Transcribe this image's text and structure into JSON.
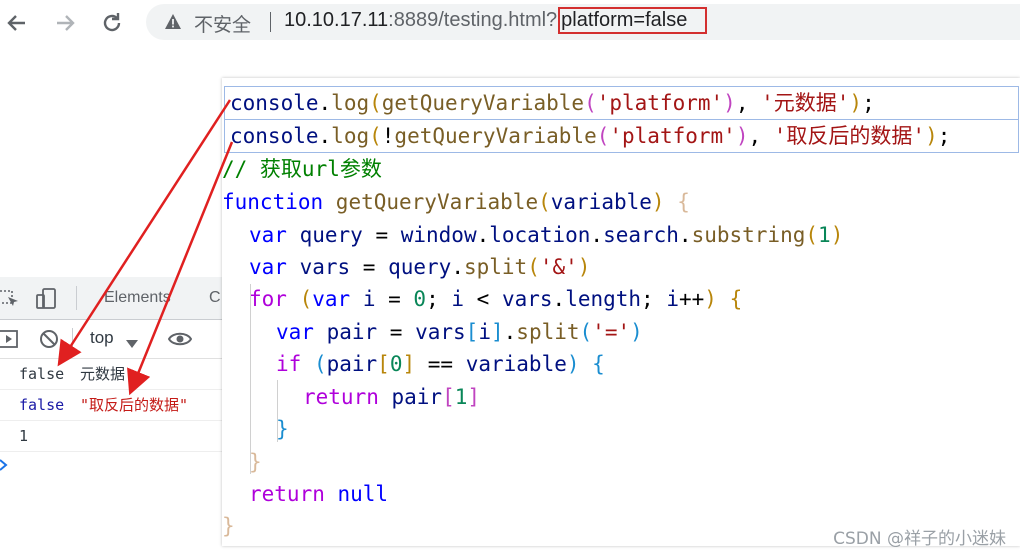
{
  "browser": {
    "security_label": "不安全",
    "url_host": "10.10.17.11",
    "url_port_path": ":8889/testing.html?",
    "url_query": "platform=false"
  },
  "devtools": {
    "tab_elements": "Elements",
    "tab_partial": "C",
    "context": "top",
    "lines": [
      {
        "value": "false",
        "text": "元数据",
        "color": "#303942",
        "text_color": "#303942"
      },
      {
        "value": "false",
        "text": "\"取反后的数据\"",
        "color": "#1a1aa6",
        "text_color": "#c41a16"
      },
      {
        "value": "1",
        "text": "",
        "color": "#303942",
        "text_color": "#303942"
      }
    ]
  },
  "code": {
    "line0": {
      "a": "console",
      "b": ".",
      "c": "log",
      "d": "(",
      "e": "getQueryVariable",
      "f": "(",
      "g": "'platform'",
      "h": ")",
      "i": ", ",
      "j": "'元数据'",
      "k": ")",
      "l": ";"
    },
    "line1": {
      "a": "console",
      "b": ".",
      "c": "log",
      "d": "(",
      "e": "!",
      "f": "getQueryVariable",
      "g": "(",
      "h": "'platform'",
      "i": ")",
      "j": ", ",
      "k": "'取反后的数据'",
      "l": ")",
      "m": ";"
    },
    "line2": {
      "a": "// 获取url参数"
    },
    "line3": {
      "a": "function",
      "b": " getQueryVariable",
      "c": "(",
      "d": "variable",
      "e": ")",
      "f": " {"
    },
    "line4": {
      "a": "var",
      "b": " query",
      "c": " = ",
      "d": "window",
      "e": ".",
      "f": "location",
      "g": ".",
      "h": "search",
      "i": ".",
      "j": "substring",
      "k": "(",
      "l": "1",
      "m": ")"
    },
    "line5": {
      "a": "var",
      "b": " vars",
      "c": " = ",
      "d": "query",
      "e": ".",
      "f": "split",
      "g": "(",
      "h": "'&'",
      "i": ")"
    },
    "line6": {
      "a": "for",
      "b": " (",
      "c": "var",
      "d": " i",
      "e": " = ",
      "f": "0",
      "g": "; ",
      "h": "i",
      "i": " < ",
      "j": "vars",
      "k": ".",
      "l": "length",
      "m": "; ",
      "n": "i",
      "o": "++",
      "p": ") {"
    },
    "line7": {
      "a": "var",
      "b": " pair",
      "c": " = ",
      "d": "vars",
      "e": "[",
      "f": "i",
      "g": "]",
      "h": ".",
      "i": "split",
      "j": "(",
      "k": "'='",
      "l": ")"
    },
    "line8": {
      "a": "if",
      "b": " (",
      "c": "pair",
      "d": "[",
      "e": "0",
      "f": "]",
      "g": " == ",
      "h": "variable",
      "i": ")",
      "j": " {"
    },
    "line9": {
      "a": "return",
      "b": " pair",
      "c": "[",
      "d": "1",
      "e": "]"
    },
    "line10": {
      "a": "}"
    },
    "line11": {
      "a": "}"
    },
    "line12": {
      "a": "return",
      "b": " null"
    },
    "line13": {
      "a": "}"
    }
  },
  "watermark": "CSDN @祥子的小迷妹",
  "colors": {
    "arrow": "#e02020",
    "highlight_box": "#d32f2f"
  }
}
